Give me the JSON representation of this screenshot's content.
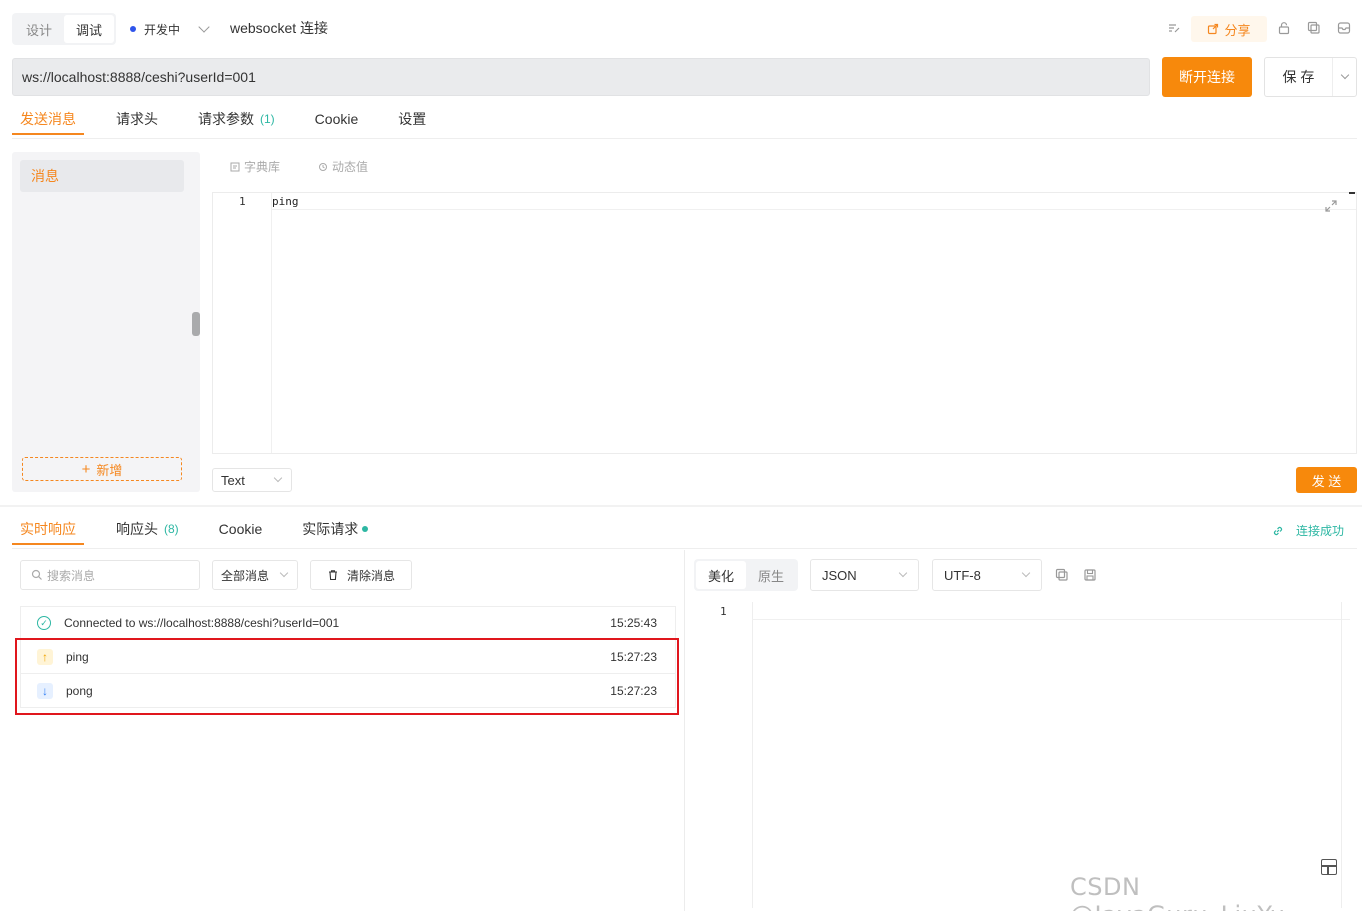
{
  "header": {
    "modes": [
      "设计",
      "调试"
    ],
    "active_mode": "调试",
    "status": "开发中",
    "title": "websocket 连接",
    "share_label": "分享"
  },
  "url_bar": {
    "url": "ws://localhost:8888/ceshi?userId=001",
    "disconnect_label": "断开连接",
    "save_label": "保 存"
  },
  "request_tabs": [
    {
      "label": "发送消息",
      "count": "",
      "active": true
    },
    {
      "label": "请求头",
      "count": ""
    },
    {
      "label": "请求参数",
      "count": "(1)"
    },
    {
      "label": "Cookie",
      "count": ""
    },
    {
      "label": "设置",
      "count": ""
    }
  ],
  "messages_panel": {
    "items": [
      "消息"
    ],
    "add_label": "新增"
  },
  "editor_tools": {
    "dictionary_label": "字典库",
    "dynamic_label": "动态值"
  },
  "editor": {
    "line_numbers": [
      "1"
    ],
    "content": "ping"
  },
  "send_row": {
    "type_value": "Text",
    "send_label": "发 送"
  },
  "response_tabs": [
    {
      "label": "实时响应",
      "count": "",
      "active": true
    },
    {
      "label": "响应头",
      "count": "(8)"
    },
    {
      "label": "Cookie",
      "count": ""
    },
    {
      "label": "实际请求",
      "count": ""
    }
  ],
  "connection_status": "连接成功",
  "log_toolbar": {
    "search_placeholder": "搜索消息",
    "filter_value": "全部消息",
    "clear_label": "清除消息"
  },
  "logs": [
    {
      "type": "connected",
      "icon": "check-circle-icon",
      "text": "Connected to ws://localhost:8888/ceshi?userId=001",
      "time": "15:25:43"
    },
    {
      "type": "sent",
      "icon": "arrow-up-icon",
      "text": "ping",
      "time": "15:27:23"
    },
    {
      "type": "received",
      "icon": "arrow-down-icon",
      "text": "pong",
      "time": "15:27:23"
    }
  ],
  "response_view": {
    "formats": [
      "美化",
      "原生"
    ],
    "active_format": "美化",
    "content_type": "JSON",
    "encoding": "UTF-8",
    "line_numbers": [
      "1"
    ]
  },
  "watermark": "CSDN @JavaGuru_LiuYu",
  "colors": {
    "accent": "#f7890c",
    "success": "#2db7a3",
    "highlight_box": "#e0161d",
    "status_dot": "#2f54eb"
  }
}
